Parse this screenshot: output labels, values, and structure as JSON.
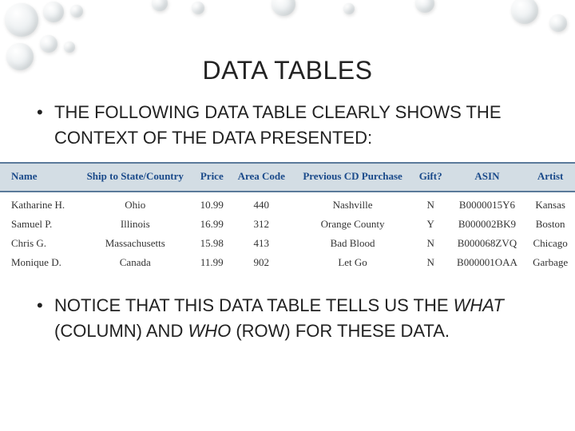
{
  "title": "DATA TABLES",
  "bullet1": "THE FOLLOWING DATA TABLE CLEARLY SHOWS THE CONTEXT OF THE DATA PRESENTED:",
  "bullet2_pre": "NOTICE THAT THIS DATA TABLE TELLS US THE ",
  "bullet2_what": "WHAT",
  "bullet2_mid1": " (COLUMN) AND ",
  "bullet2_who": "WHO",
  "bullet2_mid2": " (ROW) FOR THESE DATA.",
  "table": {
    "headers": {
      "name": "Name",
      "shipto": "Ship to State/Country",
      "price": "Price",
      "area": "Area Code",
      "prev": "Previous CD Purchase",
      "gift": "Gift?",
      "asin": "ASIN",
      "artist": "Artist"
    },
    "rows": [
      {
        "name": "Katharine H.",
        "shipto": "Ohio",
        "price": "10.99",
        "area": "440",
        "prev": "Nashville",
        "gift": "N",
        "asin": "B0000015Y6",
        "artist": "Kansas"
      },
      {
        "name": "Samuel P.",
        "shipto": "Illinois",
        "price": "16.99",
        "area": "312",
        "prev": "Orange County",
        "gift": "Y",
        "asin": "B000002BK9",
        "artist": "Boston"
      },
      {
        "name": "Chris G.",
        "shipto": "Massachusetts",
        "price": "15.98",
        "area": "413",
        "prev": "Bad Blood",
        "gift": "N",
        "asin": "B000068ZVQ",
        "artist": "Chicago"
      },
      {
        "name": "Monique D.",
        "shipto": "Canada",
        "price": "11.99",
        "area": "902",
        "prev": "Let Go",
        "gift": "N",
        "asin": "B000001OAA",
        "artist": "Garbage"
      }
    ]
  }
}
